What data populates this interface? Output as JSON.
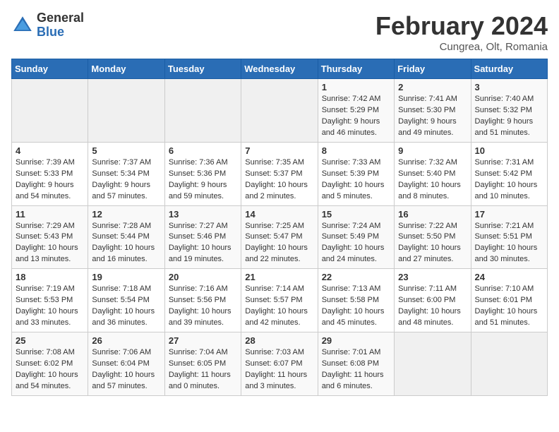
{
  "header": {
    "logo_general": "General",
    "logo_blue": "Blue",
    "month_title": "February 2024",
    "location": "Cungrea, Olt, Romania"
  },
  "days_of_week": [
    "Sunday",
    "Monday",
    "Tuesday",
    "Wednesday",
    "Thursday",
    "Friday",
    "Saturday"
  ],
  "weeks": [
    [
      {
        "day": "",
        "info": ""
      },
      {
        "day": "",
        "info": ""
      },
      {
        "day": "",
        "info": ""
      },
      {
        "day": "",
        "info": ""
      },
      {
        "day": "1",
        "info": "Sunrise: 7:42 AM\nSunset: 5:29 PM\nDaylight: 9 hours\nand 46 minutes."
      },
      {
        "day": "2",
        "info": "Sunrise: 7:41 AM\nSunset: 5:30 PM\nDaylight: 9 hours\nand 49 minutes."
      },
      {
        "day": "3",
        "info": "Sunrise: 7:40 AM\nSunset: 5:32 PM\nDaylight: 9 hours\nand 51 minutes."
      }
    ],
    [
      {
        "day": "4",
        "info": "Sunrise: 7:39 AM\nSunset: 5:33 PM\nDaylight: 9 hours\nand 54 minutes."
      },
      {
        "day": "5",
        "info": "Sunrise: 7:37 AM\nSunset: 5:34 PM\nDaylight: 9 hours\nand 57 minutes."
      },
      {
        "day": "6",
        "info": "Sunrise: 7:36 AM\nSunset: 5:36 PM\nDaylight: 9 hours\nand 59 minutes."
      },
      {
        "day": "7",
        "info": "Sunrise: 7:35 AM\nSunset: 5:37 PM\nDaylight: 10 hours\nand 2 minutes."
      },
      {
        "day": "8",
        "info": "Sunrise: 7:33 AM\nSunset: 5:39 PM\nDaylight: 10 hours\nand 5 minutes."
      },
      {
        "day": "9",
        "info": "Sunrise: 7:32 AM\nSunset: 5:40 PM\nDaylight: 10 hours\nand 8 minutes."
      },
      {
        "day": "10",
        "info": "Sunrise: 7:31 AM\nSunset: 5:42 PM\nDaylight: 10 hours\nand 10 minutes."
      }
    ],
    [
      {
        "day": "11",
        "info": "Sunrise: 7:29 AM\nSunset: 5:43 PM\nDaylight: 10 hours\nand 13 minutes."
      },
      {
        "day": "12",
        "info": "Sunrise: 7:28 AM\nSunset: 5:44 PM\nDaylight: 10 hours\nand 16 minutes."
      },
      {
        "day": "13",
        "info": "Sunrise: 7:27 AM\nSunset: 5:46 PM\nDaylight: 10 hours\nand 19 minutes."
      },
      {
        "day": "14",
        "info": "Sunrise: 7:25 AM\nSunset: 5:47 PM\nDaylight: 10 hours\nand 22 minutes."
      },
      {
        "day": "15",
        "info": "Sunrise: 7:24 AM\nSunset: 5:49 PM\nDaylight: 10 hours\nand 24 minutes."
      },
      {
        "day": "16",
        "info": "Sunrise: 7:22 AM\nSunset: 5:50 PM\nDaylight: 10 hours\nand 27 minutes."
      },
      {
        "day": "17",
        "info": "Sunrise: 7:21 AM\nSunset: 5:51 PM\nDaylight: 10 hours\nand 30 minutes."
      }
    ],
    [
      {
        "day": "18",
        "info": "Sunrise: 7:19 AM\nSunset: 5:53 PM\nDaylight: 10 hours\nand 33 minutes."
      },
      {
        "day": "19",
        "info": "Sunrise: 7:18 AM\nSunset: 5:54 PM\nDaylight: 10 hours\nand 36 minutes."
      },
      {
        "day": "20",
        "info": "Sunrise: 7:16 AM\nSunset: 5:56 PM\nDaylight: 10 hours\nand 39 minutes."
      },
      {
        "day": "21",
        "info": "Sunrise: 7:14 AM\nSunset: 5:57 PM\nDaylight: 10 hours\nand 42 minutes."
      },
      {
        "day": "22",
        "info": "Sunrise: 7:13 AM\nSunset: 5:58 PM\nDaylight: 10 hours\nand 45 minutes."
      },
      {
        "day": "23",
        "info": "Sunrise: 7:11 AM\nSunset: 6:00 PM\nDaylight: 10 hours\nand 48 minutes."
      },
      {
        "day": "24",
        "info": "Sunrise: 7:10 AM\nSunset: 6:01 PM\nDaylight: 10 hours\nand 51 minutes."
      }
    ],
    [
      {
        "day": "25",
        "info": "Sunrise: 7:08 AM\nSunset: 6:02 PM\nDaylight: 10 hours\nand 54 minutes."
      },
      {
        "day": "26",
        "info": "Sunrise: 7:06 AM\nSunset: 6:04 PM\nDaylight: 10 hours\nand 57 minutes."
      },
      {
        "day": "27",
        "info": "Sunrise: 7:04 AM\nSunset: 6:05 PM\nDaylight: 11 hours\nand 0 minutes."
      },
      {
        "day": "28",
        "info": "Sunrise: 7:03 AM\nSunset: 6:07 PM\nDaylight: 11 hours\nand 3 minutes."
      },
      {
        "day": "29",
        "info": "Sunrise: 7:01 AM\nSunset: 6:08 PM\nDaylight: 11 hours\nand 6 minutes."
      },
      {
        "day": "",
        "info": ""
      },
      {
        "day": "",
        "info": ""
      }
    ]
  ]
}
